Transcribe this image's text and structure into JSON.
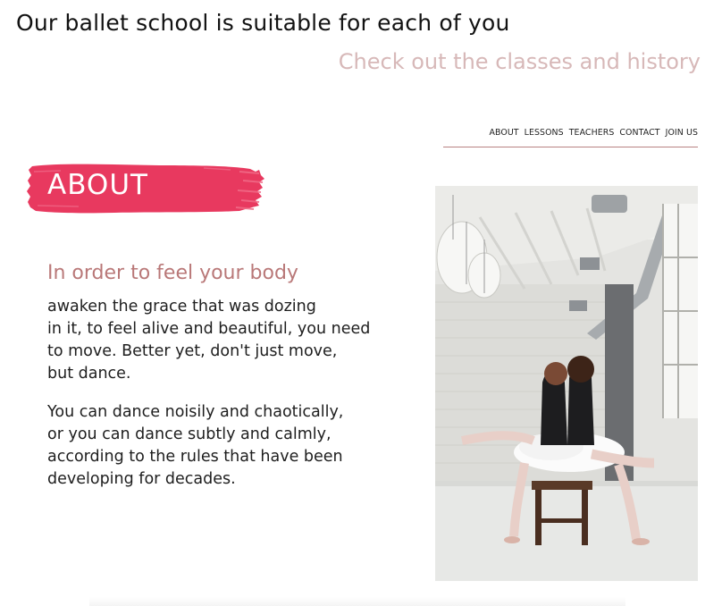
{
  "header": {
    "headline": "Our ballet school is suitable for each of you",
    "subheadline": "Check out the classes and history"
  },
  "nav": {
    "items": [
      {
        "label": "ABOUT"
      },
      {
        "label": "LESSONS"
      },
      {
        "label": "TEACHERS"
      },
      {
        "label": "CONTACT"
      },
      {
        "label": "JOIN US"
      }
    ]
  },
  "about": {
    "badge": "ABOUT",
    "title": "In order to feel your body",
    "paragraph1": "awaken the grace that was dozing\nin it, to feel alive and beautiful, you need\nto move. Better yet, don't just move,\nbut dance.",
    "paragraph2": "You can dance noisily and chaotically,\nor you can dance subtly and calmly,\naccording to the rules that have been\ndeveloping for decades."
  },
  "colors": {
    "accent_pink": "#e8395f",
    "title_rose": "#b97878",
    "subheadline_rose": "#d7b8b8",
    "nav_underline": "#b98282"
  }
}
